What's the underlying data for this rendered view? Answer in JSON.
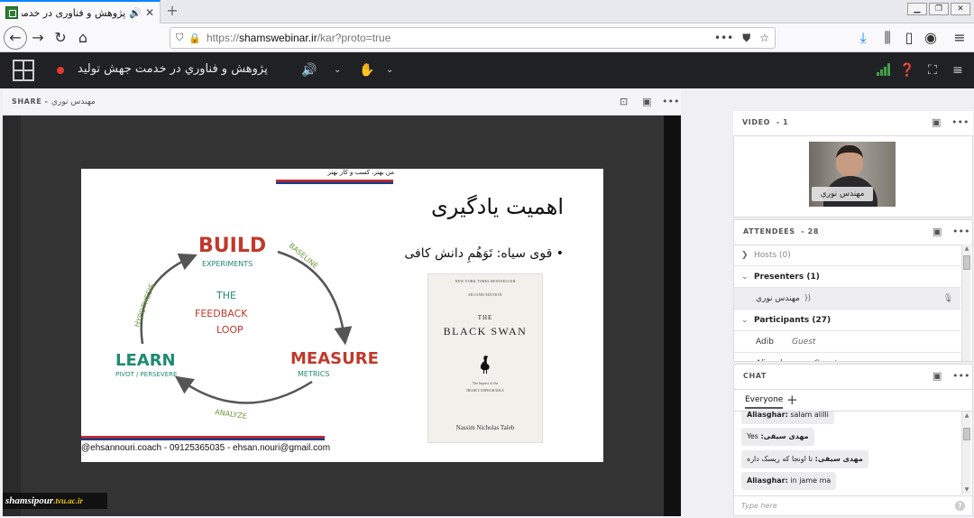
{
  "browser": {
    "tab_title": "پژوهش و فناوری در خدمت جهش تولید",
    "url_scheme": "https://",
    "url_host": "shamswebinar.ir",
    "url_path": "/kar?proto=true"
  },
  "app": {
    "meeting_title": "پژوهش و فناوري در خدمت جهش توليد"
  },
  "share_pod": {
    "title": "SHARE",
    "presenter": "مهندس نوري"
  },
  "slide": {
    "tagline": "من بهتر، کسب و کار بهتر",
    "title": "اهمیت یادگیری",
    "bullet": "• قوی سیاه: تَوَهُمِ دانش کافی",
    "loop": {
      "build": "BUILD",
      "experiments": "EXPERIMENTS",
      "baseline": "BASELINE",
      "measure": "MEASURE",
      "metrics": "METRICS",
      "analyze": "ANALYZE",
      "learn": "LEARN",
      "pivot": "PIVOT / PERSEVERE",
      "hypothesis": "HYPOTHESIS",
      "center1": "THE",
      "center2": "FEEDBACK",
      "center3": "LOOP"
    },
    "book": {
      "top": "NEW YORK TIMES BESTSELLER",
      "edition": "SECOND EDITION",
      "the": "THE",
      "title": "BLACK SWAN",
      "subtitle1": "The Impact of the",
      "subtitle2": "HIGHLY IMPROBABLE",
      "author": "Nassim Nicholas Taleb"
    },
    "footer": "@ehsannouri.coach - 09125365035 - ehsan.nouri@gmail.com"
  },
  "watermark": {
    "name": "shamsipour",
    "host": ".tvu.ac.ir"
  },
  "video_pod": {
    "title": "VIDEO",
    "count": "- 1",
    "name": "مهندس نوري"
  },
  "attendees_pod": {
    "title": "ATTENDEES",
    "count": "- 28",
    "hosts": "Hosts (0)",
    "presenters": "Presenters (1)",
    "presenter_name": "مهندس نوري",
    "participants": "Participants (27)",
    "p1_name": "Adib",
    "p1_role": "Guest",
    "p2_name": "Aliasghar",
    "p2_role": "Guest"
  },
  "chat_pod": {
    "title": "CHAT",
    "tab": "Everyone",
    "messages": [
      {
        "who": "Aliasghar:",
        "text": " salam alilli"
      },
      {
        "who": "مهدی سیفی:",
        "text": " Yes"
      },
      {
        "who": "مهدی سیفی:",
        "text": " تا اونجا که ریسک داره"
      },
      {
        "who": "Aliasghar:",
        "text": " in jame ma"
      }
    ],
    "placeholder": "Type here"
  },
  "colors": {
    "header_bg": "#202124",
    "loop_red": "#c0392b",
    "loop_green": "#1f8a70",
    "slide_bar_red": "#c62828",
    "slide_bar_blue": "#1a3c8a"
  }
}
